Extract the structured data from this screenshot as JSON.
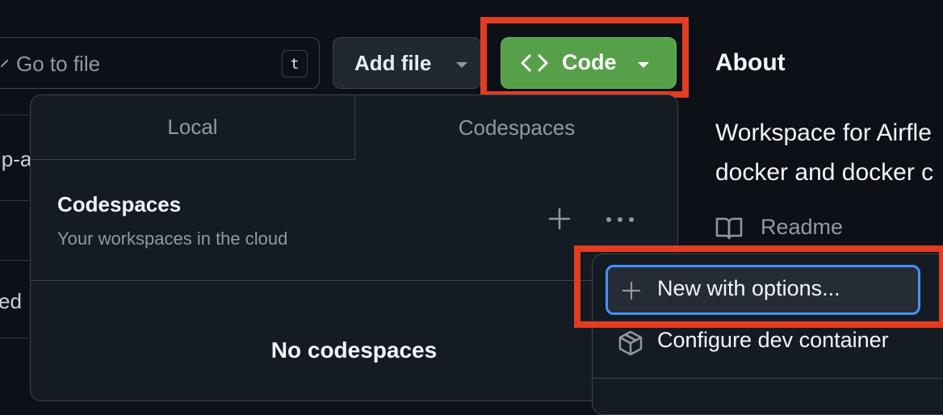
{
  "left_fragments": [
    "ip-a",
    "ed"
  ],
  "search": {
    "placeholder": "Go to file",
    "shortcut": "t"
  },
  "toolbar": {
    "add_file_label": "Add file",
    "code_label": "Code"
  },
  "about": {
    "title": "About",
    "description": "Workspace for Airfle\ndocker and docker c",
    "readme_label": "Readme",
    "trailing_char": "e"
  },
  "code_panel": {
    "tabs": [
      {
        "label": "Local",
        "selected": false
      },
      {
        "label": "Codespaces",
        "selected": true
      }
    ],
    "section_title": "Codespaces",
    "section_subtitle": "Your workspaces in the cloud",
    "empty_state": "No codespaces"
  },
  "codespaces_menu": {
    "items": [
      {
        "label": "New with options...",
        "icon": "plus-icon",
        "focused": true
      },
      {
        "label": "Configure dev container",
        "icon": "container-icon",
        "focused": false
      }
    ]
  },
  "colors": {
    "code_button": "#57a04a",
    "highlight": "#e23c22",
    "focus_ring": "#4493f8",
    "background": "#0d1117"
  }
}
